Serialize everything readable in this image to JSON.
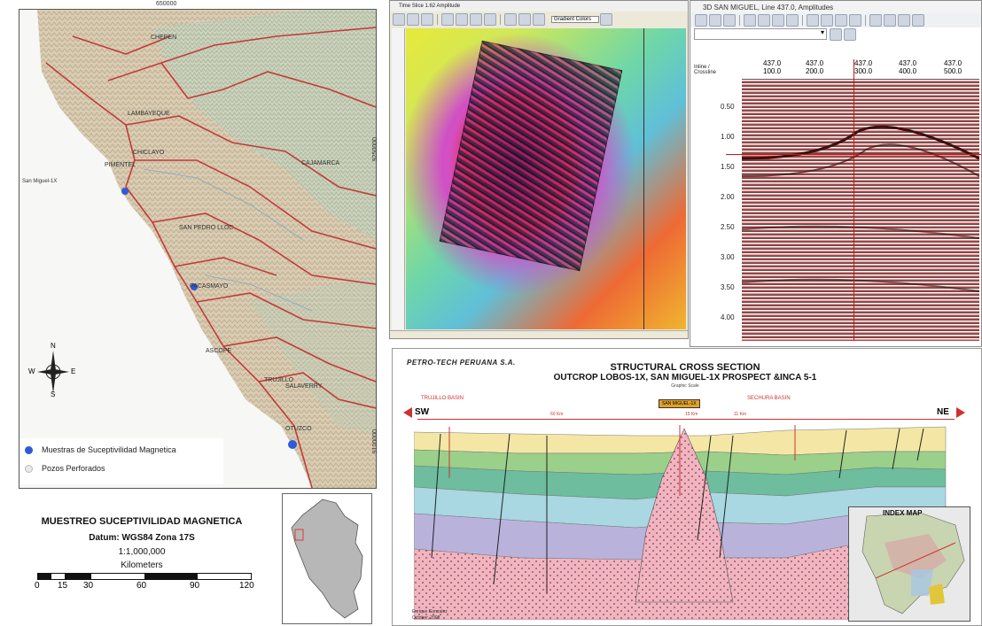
{
  "map": {
    "top_coord": "650000",
    "right_coord_1": "9250000",
    "right_coord_2": "9100000",
    "left_label": "San Miguel-1X",
    "places": [
      "LAMBAYEQUE",
      "CHICLAYO",
      "PIMENTEL",
      "CAJAMARCA",
      "SAN PEDRO LLOC",
      "PACASMAYO",
      "ASCOPE",
      "TRUJILLO",
      "SALAVERRY",
      "OTUZCO",
      "CHEPEN"
    ],
    "compass": {
      "n": "N",
      "s": "S",
      "e": "E",
      "w": "W"
    },
    "legend": [
      {
        "label": "Muestras de Suceptivilidad Magnetica",
        "color": "#2f5bd8"
      },
      {
        "label": "Pozos Perforados",
        "color": "#e9e9e9"
      }
    ]
  },
  "map_info": {
    "title": "MUESTREO SUCEPTIVILIDAD MAGNETICA",
    "datum": "Datum: WGS84 Zona 17S",
    "scale": "1:1,000,000",
    "units": "Kilometers",
    "ticks": [
      "0",
      "15",
      "30",
      "60",
      "90",
      "120"
    ]
  },
  "window_mag": {
    "title": "Time Slice 1.62 Amplitude",
    "dropdown": "Gradient Colors"
  },
  "window_seismic": {
    "title": "3D SAN MIGUEL, Line 437.0, Amplitudes",
    "col_header_label": "Inline / Crossline",
    "col_headers": [
      {
        "a": "437.0",
        "b": "100.0"
      },
      {
        "a": "437.0",
        "b": "200.0"
      },
      {
        "a": "437.0",
        "b": "300.0"
      },
      {
        "a": "437.0",
        "b": "400.0"
      },
      {
        "a": "437.0",
        "b": "500.0"
      }
    ],
    "times": [
      "0.50",
      "1.00",
      "1.50",
      "2.00",
      "2.50",
      "3.00",
      "3.50",
      "4.00"
    ]
  },
  "cross_section": {
    "logo": "PETRO-TECH PERUANA S.A.",
    "title": "STRUCTURAL CROSS SECTION",
    "subtitle": "OUTCROP LOBOS-1X, SAN MIGUEL-1X PROSPECT  &INCA 5-1",
    "scale_note": "Graphic Scale",
    "left_dir": "SW",
    "right_dir": "NE",
    "basin_left": "TRUJILLO BASIN",
    "basin_right": "SECHURA BASIN",
    "prospect_label": "SAN MIGUEL-1X",
    "distance_1": "60 Km",
    "distance_2": "15 Km",
    "distance_3": "11 Km",
    "index_map": "INDEX MAP",
    "author": "Enrique Gonzalez",
    "date": "October, 2008"
  }
}
